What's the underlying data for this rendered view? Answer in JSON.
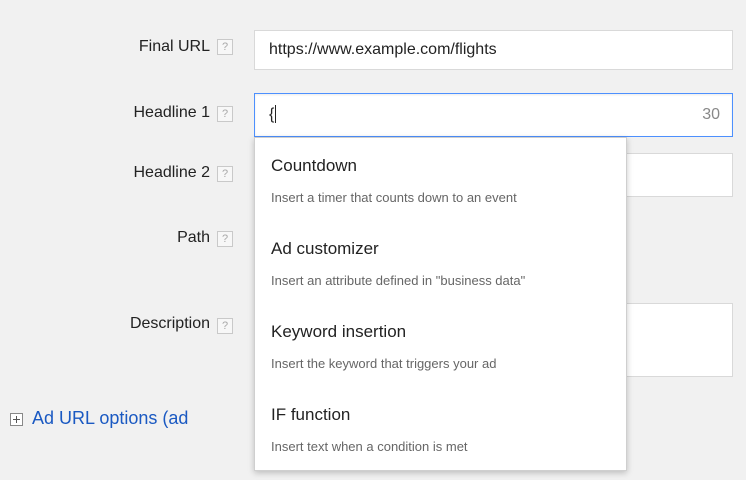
{
  "form": {
    "final_url": {
      "label": "Final URL",
      "help": "?",
      "value": "https://www.example.com/flights"
    },
    "headline1": {
      "label": "Headline 1",
      "help": "?",
      "value": "{",
      "char_count": "30"
    },
    "headline2": {
      "label": "Headline 2",
      "help": "?"
    },
    "path": {
      "label": "Path",
      "help": "?"
    },
    "description": {
      "label": "Description",
      "help": "?"
    },
    "ad_url_options_label": "Ad URL options (ad"
  },
  "dropdown": {
    "items": [
      {
        "title": "Countdown",
        "description": "Insert a timer that counts down to an event"
      },
      {
        "title": "Ad customizer",
        "description": "Insert an attribute defined in \"business data\""
      },
      {
        "title": "Keyword insertion",
        "description": "Insert the keyword that triggers your ad"
      },
      {
        "title": "IF function",
        "description": "Insert text when a condition is met"
      }
    ]
  },
  "colors": {
    "background": "#f1f1f1",
    "link_blue": "#1a59c2",
    "focus_border": "#4d90fe"
  },
  "icons": {
    "help": "question-mark-icon",
    "expand": "plus-box-icon"
  }
}
